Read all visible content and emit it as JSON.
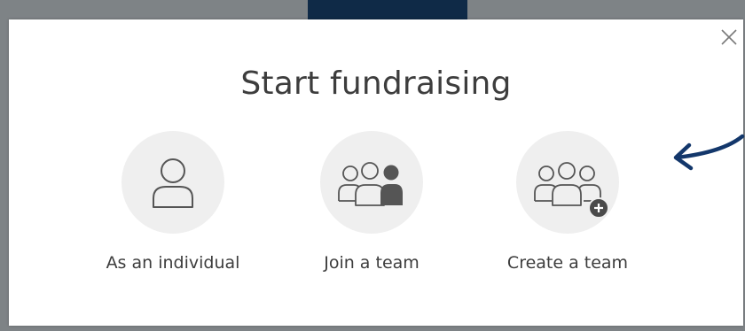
{
  "modal": {
    "title": "Start fundraising",
    "close_label": "×"
  },
  "options": [
    {
      "label": "As an individual",
      "icon": "person-icon"
    },
    {
      "label": "Join a team",
      "icon": "join-team-icon"
    },
    {
      "label": "Create a team",
      "icon": "create-team-icon"
    }
  ],
  "colors": {
    "backdrop": "#7e8386",
    "backdrop_tab": "#0f2a47",
    "icon_circle": "#efefef",
    "icon_stroke": "#555555",
    "icon_fill_dark": "#555555",
    "text": "#3d3d3d",
    "arrow": "#13376b"
  }
}
